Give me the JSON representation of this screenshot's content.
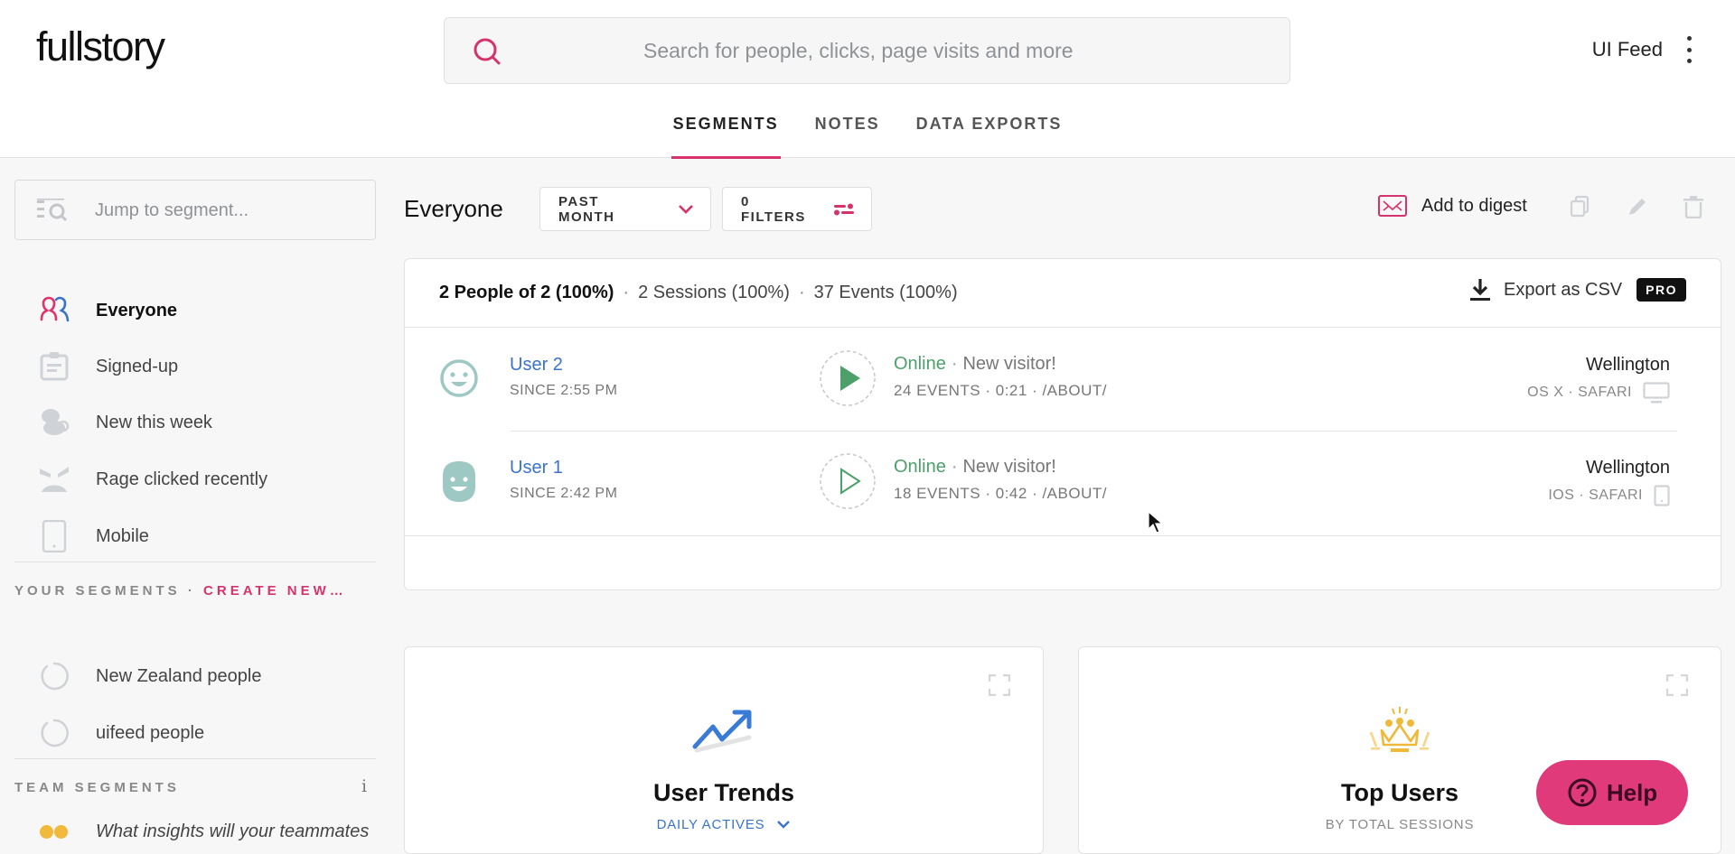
{
  "app": {
    "logo": "fullstory"
  },
  "header": {
    "search_placeholder": "Search for people, clicks, page visits and more",
    "account_name": "UI Feed"
  },
  "tabs": [
    {
      "label": "SEGMENTS",
      "active": true
    },
    {
      "label": "NOTES",
      "active": false
    },
    {
      "label": "DATA EXPORTS",
      "active": false
    }
  ],
  "sidebar": {
    "jump_placeholder": "Jump to segment...",
    "default_segments": [
      {
        "label": "Everyone",
        "icon": "people-icon",
        "active": true
      },
      {
        "label": "Signed-up",
        "icon": "clipboard-icon",
        "active": false
      },
      {
        "label": "New this week",
        "icon": "baby-icon",
        "active": false
      },
      {
        "label": "Rage clicked recently",
        "icon": "angry-face-icon",
        "active": false
      },
      {
        "label": "Mobile",
        "icon": "mobile-icon",
        "active": false
      }
    ],
    "your_segments_heading": "YOUR SEGMENTS",
    "separator": "·",
    "create_new_label": "CREATE NEW…",
    "your_segments": [
      {
        "label": "New Zealand people",
        "icon": "loading-spinner-icon"
      },
      {
        "label": "uifeed people",
        "icon": "loading-spinner-icon"
      }
    ],
    "team_segments_heading": "TEAM SEGMENTS",
    "team_info_label": "i",
    "team_hint": "What insights will your teammates"
  },
  "segment": {
    "title": "Everyone",
    "date_range": "PAST MONTH",
    "filters": "0 FILTERS",
    "add_to_digest": "Add to digest",
    "actions": [
      "copy-icon",
      "edit-icon",
      "delete-icon"
    ]
  },
  "summary": {
    "people": "2 People of 2 (100%)",
    "sessions": "2 Sessions (100%)",
    "events": "37 Events (100%)",
    "separator": "·",
    "export_label": "Export as CSV",
    "pro_badge": "PRO"
  },
  "users": [
    {
      "name": "User 2",
      "since": "SINCE 2:55 PM",
      "avatar": "smiley-avatar",
      "status": "Online",
      "visitor": "New visitor!",
      "session": "24 EVENTS · 0:21 · /ABOUT/",
      "city": "Wellington",
      "platform": "OS X · SAFARI",
      "device": "desktop-icon",
      "play_filled": true
    },
    {
      "name": "User 1",
      "since": "SINCE 2:42 PM",
      "avatar": "bearded-avatar",
      "status": "Online",
      "visitor": "New visitor!",
      "session": "18 EVENTS · 0:42 · /ABOUT/",
      "city": "Wellington",
      "platform": "IOS · SAFARI",
      "device": "mobile-icon",
      "play_filled": false
    }
  ],
  "cards": [
    {
      "title": "User Trends",
      "subtitle": "DAILY ACTIVES",
      "icon": "trend-up-icon"
    },
    {
      "title": "Top Users",
      "subtitle": "BY TOTAL SESSIONS",
      "icon": "crown-icon"
    }
  ],
  "help": {
    "label": "Help"
  },
  "colors": {
    "accent": "#d6336c",
    "link": "#3a73c9",
    "online": "#4da06a",
    "help": "#e13a7a",
    "crown": "#f0b93a"
  }
}
